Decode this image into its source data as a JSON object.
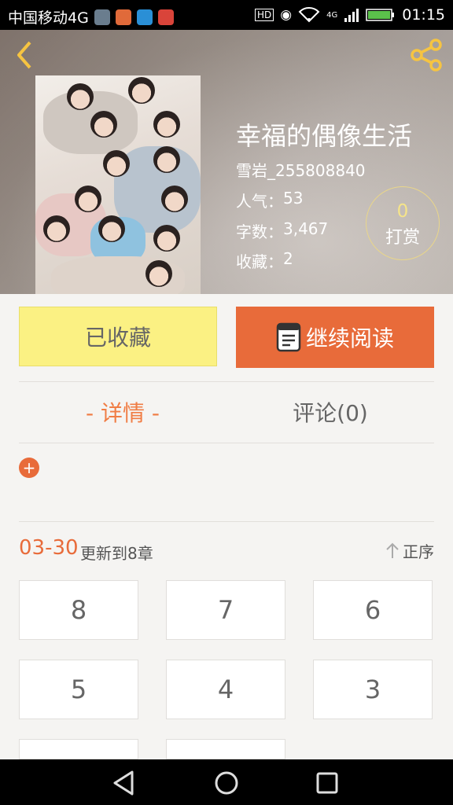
{
  "status_bar": {
    "carrier": "中国移动4G",
    "network": "4G",
    "time": "01:15"
  },
  "header": {
    "book_title": "幸福的偶像生活",
    "author": "雪岩_255808840",
    "popularity_label": "人气：",
    "popularity_value": "53",
    "wordcount_label": "字数：",
    "wordcount_value": "3,467",
    "favorites_label": "收藏：",
    "favorites_value": "2",
    "reward_count": "0",
    "reward_label": "打赏"
  },
  "actions": {
    "collected_label": "已收藏",
    "continue_label": "继续阅读"
  },
  "tabs": {
    "detail_label": "- 详情 -",
    "comment_label": "评论(0)"
  },
  "update": {
    "date": "03-30",
    "text": "更新到8章",
    "sort_label": "正序"
  },
  "chapters": [
    "8",
    "7",
    "6",
    "5",
    "4",
    "3"
  ],
  "colors": {
    "accent": "#e86b3a",
    "collected_bg": "#fbf183",
    "tab_active": "#f07d45"
  },
  "icons": {
    "back": "chevron-left-icon",
    "share": "share-icon",
    "book": "book-icon",
    "plus": "plus-icon",
    "sort": "arrow-up-icon"
  }
}
